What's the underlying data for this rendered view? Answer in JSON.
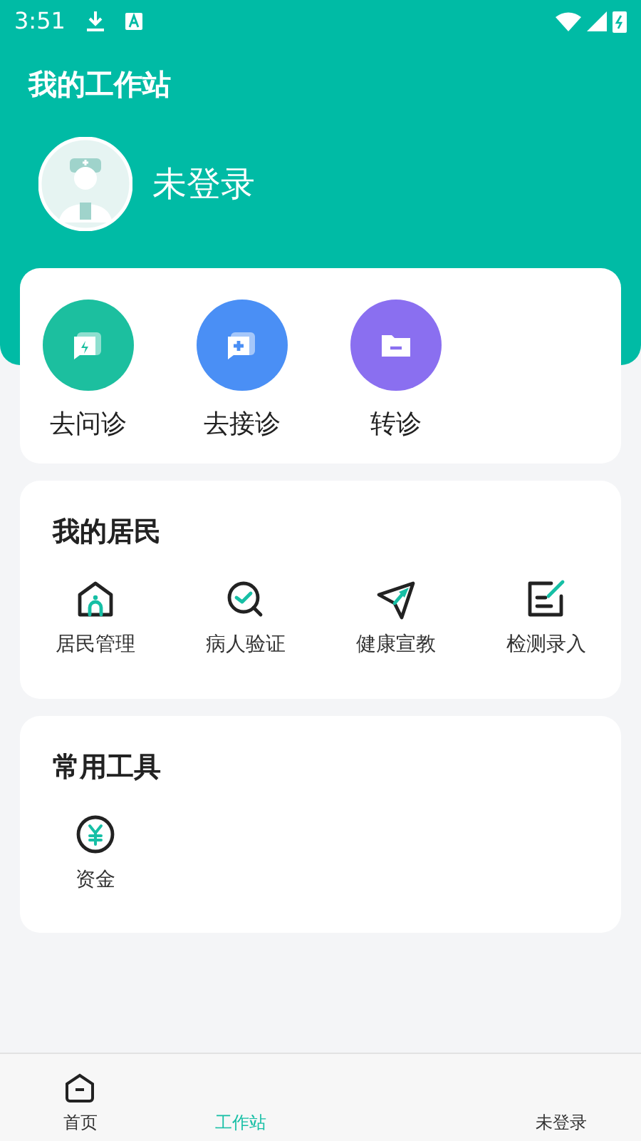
{
  "status_bar": {
    "time": "3:51"
  },
  "header": {
    "title": "我的工作站",
    "user_name": "未登录"
  },
  "quick_actions": [
    {
      "label": "去问诊",
      "kind": "consult",
      "color": "#1cbf9f"
    },
    {
      "label": "去接诊",
      "kind": "receive",
      "color": "#4a8ff5"
    },
    {
      "label": "转诊",
      "kind": "referral",
      "color": "#8a6ff0"
    }
  ],
  "residents": {
    "title": "我的居民",
    "items": [
      {
        "label": "居民管理",
        "kind": "house"
      },
      {
        "label": "病人验证",
        "kind": "verify"
      },
      {
        "label": "健康宣教",
        "kind": "send"
      },
      {
        "label": "检测录入",
        "kind": "edit"
      }
    ]
  },
  "tools": {
    "title": "常用工具",
    "items": [
      {
        "label": "资金",
        "kind": "money"
      }
    ]
  },
  "bottom_nav": [
    {
      "label": "首页",
      "kind": "home",
      "selected": false
    },
    {
      "label": "工作站",
      "kind": "station",
      "selected": true
    },
    {
      "label": "未登录",
      "kind": "me",
      "selected": false
    }
  ]
}
